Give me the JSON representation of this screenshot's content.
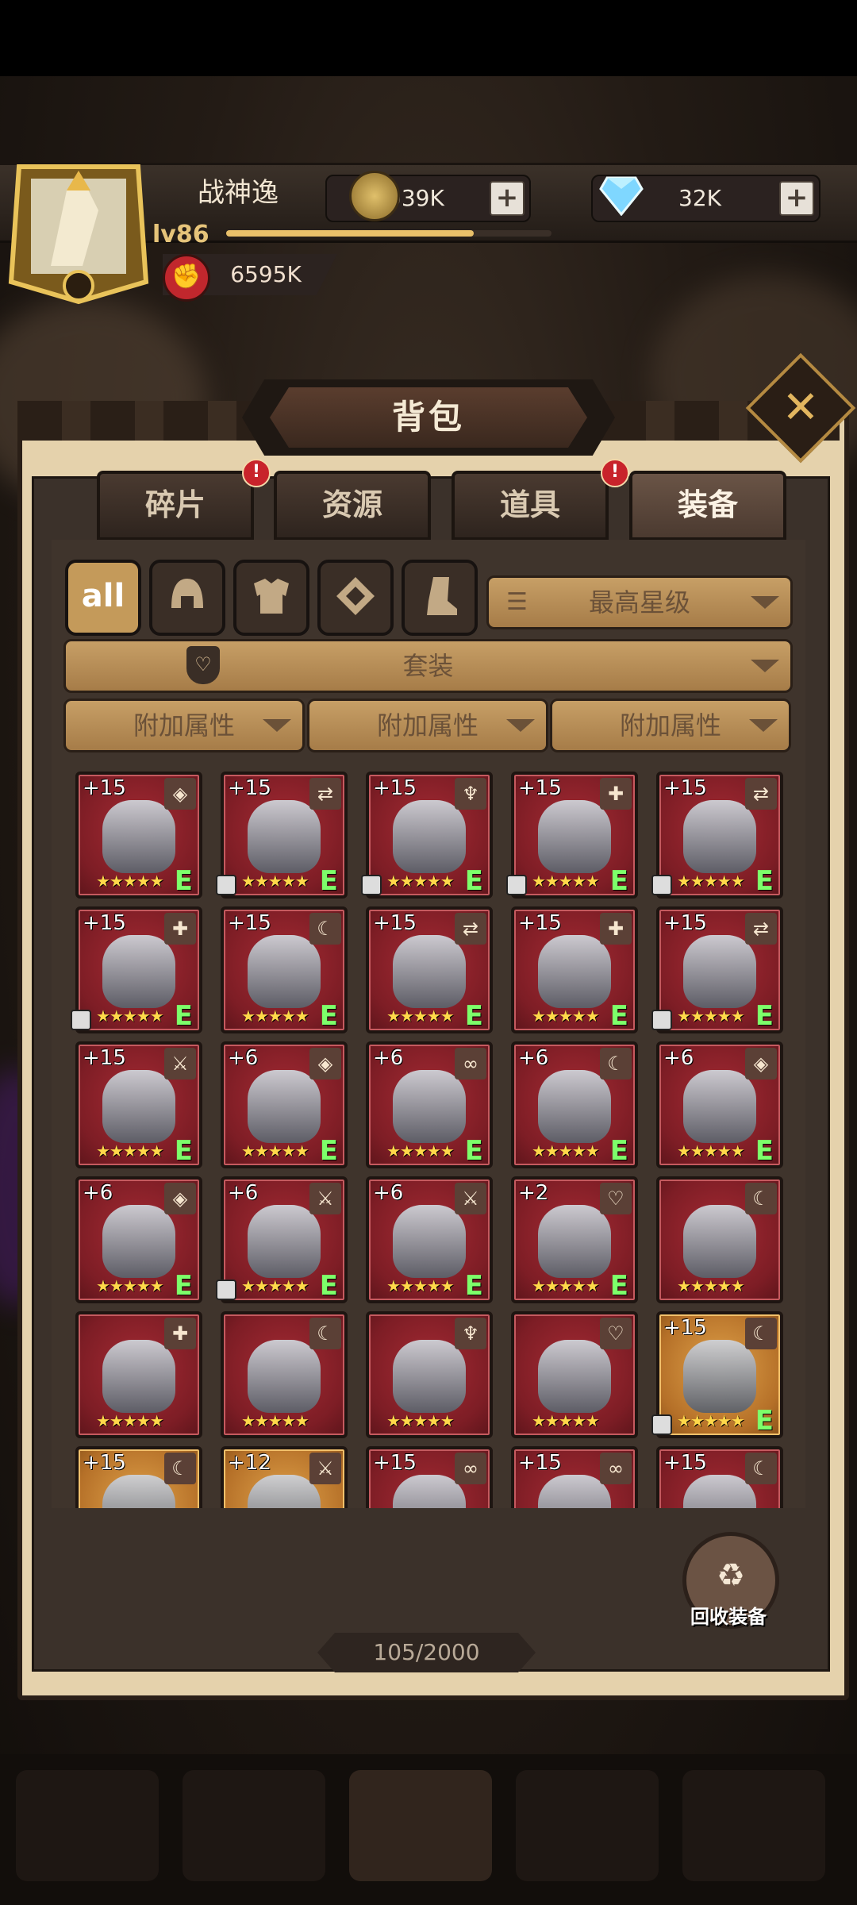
{
  "player": {
    "name": "战神逸",
    "level": "lv86",
    "xp_fraction": 0.76,
    "power": "6595K"
  },
  "currency": {
    "gold": "9039K",
    "diamond": "32K",
    "plus_label": "+"
  },
  "panel": {
    "title": "背包",
    "close_label": "✕"
  },
  "tabs": [
    {
      "label": "碎片",
      "badge": "!"
    },
    {
      "label": "资源",
      "badge": ""
    },
    {
      "label": "道具",
      "badge": "!"
    },
    {
      "label": "装备",
      "badge": "",
      "active": true
    }
  ],
  "filters": {
    "type_buttons": [
      "all",
      "helmet-icon",
      "armor-icon",
      "accessory-icon",
      "boots-icon"
    ],
    "sort": "最高星级",
    "set": "套装",
    "attr1": "附加属性",
    "attr2": "附加属性",
    "attr3": "附加属性"
  },
  "items": [
    {
      "level": "+15",
      "stars": "★★★★★",
      "grade": "E",
      "tag": "◈",
      "locked": false
    },
    {
      "level": "+15",
      "stars": "★★★★★",
      "grade": "E",
      "tag": "⇄",
      "locked": true
    },
    {
      "level": "+15",
      "stars": "★★★★★",
      "grade": "E",
      "tag": "♆",
      "locked": true
    },
    {
      "level": "+15",
      "stars": "★★★★★",
      "grade": "E",
      "tag": "✚",
      "locked": true
    },
    {
      "level": "+15",
      "stars": "★★★★★",
      "grade": "E",
      "tag": "⇄",
      "locked": true
    },
    {
      "level": "+15",
      "stars": "★★★★★",
      "grade": "E",
      "tag": "✚",
      "locked": true
    },
    {
      "level": "+15",
      "stars": "★★★★★",
      "grade": "E",
      "tag": "☾",
      "locked": false
    },
    {
      "level": "+15",
      "stars": "★★★★★",
      "grade": "E",
      "tag": "⇄",
      "locked": false
    },
    {
      "level": "+15",
      "stars": "★★★★★",
      "grade": "E",
      "tag": "✚",
      "locked": false
    },
    {
      "level": "+15",
      "stars": "★★★★★",
      "grade": "E",
      "tag": "⇄",
      "locked": true
    },
    {
      "level": "+15",
      "stars": "★★★★★",
      "grade": "E",
      "tag": "⚔",
      "locked": false
    },
    {
      "level": "+6",
      "stars": "★★★★★",
      "grade": "E",
      "tag": "◈",
      "locked": false
    },
    {
      "level": "+6",
      "stars": "★★★★★",
      "grade": "E",
      "tag": "∞",
      "locked": false
    },
    {
      "level": "+6",
      "stars": "★★★★★",
      "grade": "E",
      "tag": "☾",
      "locked": false
    },
    {
      "level": "+6",
      "stars": "★★★★★",
      "grade": "E",
      "tag": "◈",
      "locked": false
    },
    {
      "level": "+6",
      "stars": "★★★★★",
      "grade": "E",
      "tag": "◈",
      "locked": false
    },
    {
      "level": "+6",
      "stars": "★★★★★",
      "grade": "E",
      "tag": "⚔",
      "locked": true
    },
    {
      "level": "+6",
      "stars": "★★★★★",
      "grade": "E",
      "tag": "⚔",
      "locked": false
    },
    {
      "level": "+2",
      "stars": "★★★★★",
      "grade": "E",
      "tag": "♡",
      "locked": false
    },
    {
      "level": "",
      "stars": "★★★★★",
      "grade": "",
      "tag": "☾",
      "locked": false
    },
    {
      "level": "",
      "stars": "★★★★★",
      "grade": "",
      "tag": "✚",
      "locked": false
    },
    {
      "level": "",
      "stars": "★★★★★",
      "grade": "",
      "tag": "☾",
      "locked": false
    },
    {
      "level": "",
      "stars": "★★★★★",
      "grade": "",
      "tag": "♆",
      "locked": false
    },
    {
      "level": "",
      "stars": "★★★★★",
      "grade": "",
      "tag": "♡",
      "locked": false
    },
    {
      "level": "+15",
      "stars": "★★★★★",
      "grade": "E",
      "tag": "☾",
      "locked": true,
      "gold": true
    },
    {
      "level": "+15",
      "stars": "",
      "grade": "",
      "tag": "☾",
      "locked": false,
      "gold": true
    },
    {
      "level": "+12",
      "stars": "",
      "grade": "",
      "tag": "⚔",
      "locked": false,
      "gold": true
    },
    {
      "level": "+15",
      "stars": "",
      "grade": "",
      "tag": "∞",
      "locked": false
    },
    {
      "level": "+15",
      "stars": "",
      "grade": "",
      "tag": "∞",
      "locked": false
    },
    {
      "level": "+15",
      "stars": "",
      "grade": "",
      "tag": "☾",
      "locked": false
    }
  ],
  "recycle": {
    "label": "回收装备"
  },
  "capacity": "105/2000"
}
